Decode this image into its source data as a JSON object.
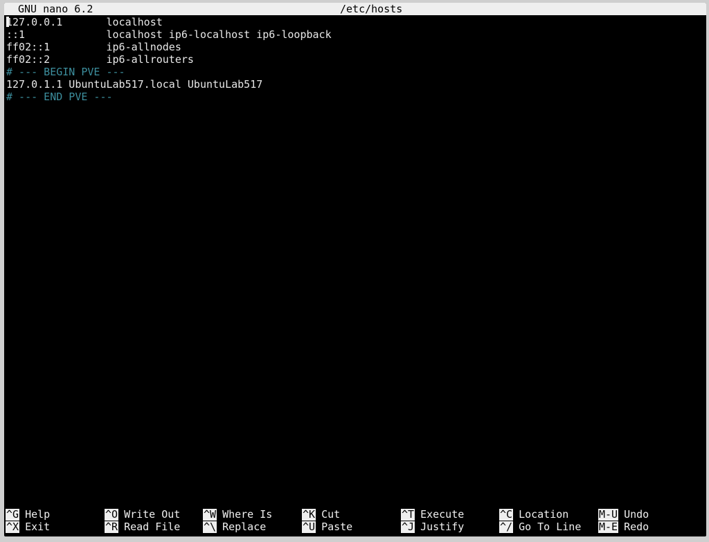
{
  "titlebar": {
    "app": "GNU nano 6.2",
    "file": "/etc/hosts"
  },
  "lines": [
    {
      "text": "127.0.0.1       localhost",
      "comment": false
    },
    {
      "text": "::1             localhost ip6-localhost ip6-loopback",
      "comment": false
    },
    {
      "text": "ff02::1         ip6-allnodes",
      "comment": false
    },
    {
      "text": "ff02::2         ip6-allrouters",
      "comment": false
    },
    {
      "text": "# --- BEGIN PVE ---",
      "comment": true
    },
    {
      "text": "127.0.1.1 UbuntuLab517.local UbuntuLab517",
      "comment": false
    },
    {
      "text": "# --- END PVE ---",
      "comment": true
    }
  ],
  "shortcuts": {
    "row1": [
      {
        "key": "^G",
        "label": "Help"
      },
      {
        "key": "^O",
        "label": "Write Out"
      },
      {
        "key": "^W",
        "label": "Where Is"
      },
      {
        "key": "^K",
        "label": "Cut"
      },
      {
        "key": "^T",
        "label": "Execute"
      },
      {
        "key": "^C",
        "label": "Location"
      },
      {
        "key": "M-U",
        "label": "Undo"
      }
    ],
    "row2": [
      {
        "key": "^X",
        "label": "Exit"
      },
      {
        "key": "^R",
        "label": "Read File"
      },
      {
        "key": "^\\",
        "label": "Replace"
      },
      {
        "key": "^U",
        "label": "Paste"
      },
      {
        "key": "^J",
        "label": "Justify"
      },
      {
        "key": "^/",
        "label": "Go To Line"
      },
      {
        "key": "M-E",
        "label": "Redo"
      }
    ]
  }
}
